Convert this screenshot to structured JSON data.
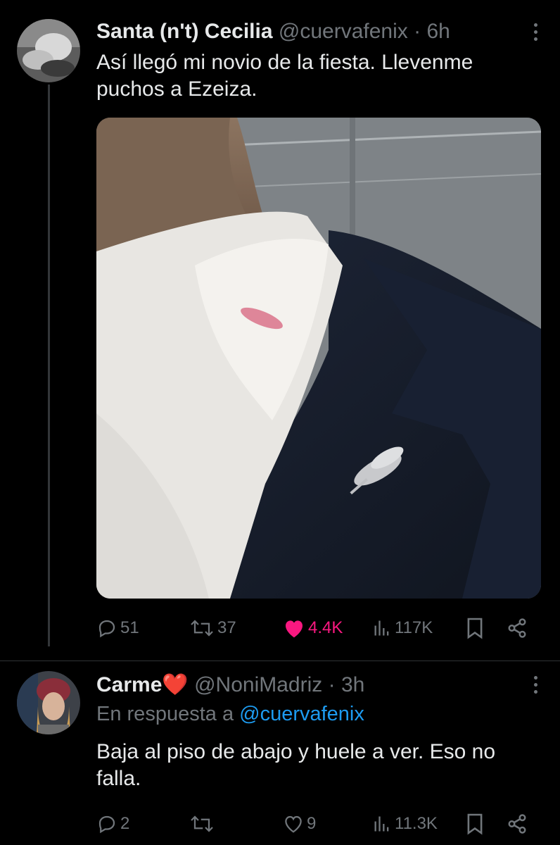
{
  "tweets": [
    {
      "author_name": "Santa (n't) Cecilia",
      "handle": "@cuervafenix",
      "time": "6h",
      "text": "Así llegó mi novio de la fiesta. Llevenme puchos a Ezeiza.",
      "media_icon": "photo-man-collar-lipstick",
      "replies": "51",
      "retweets": "37",
      "likes": "4.4K",
      "views": "117K"
    },
    {
      "author_name": "Carme",
      "author_emoji": "❤️",
      "handle": "@NoniMadriz",
      "time": "3h",
      "reply_prefix": "En respuesta a",
      "reply_handle": "@cuervafenix",
      "text": "Baja al piso de abajo y huele a ver. Eso no falla.",
      "replies": "2",
      "retweets": "",
      "likes": "9",
      "views": "11.3K"
    }
  ],
  "separator": "·",
  "colors": {
    "background": "#000000",
    "text": "#e7e9ea",
    "muted": "#71767b",
    "like": "#f91880",
    "link": "#1d9bf0"
  }
}
